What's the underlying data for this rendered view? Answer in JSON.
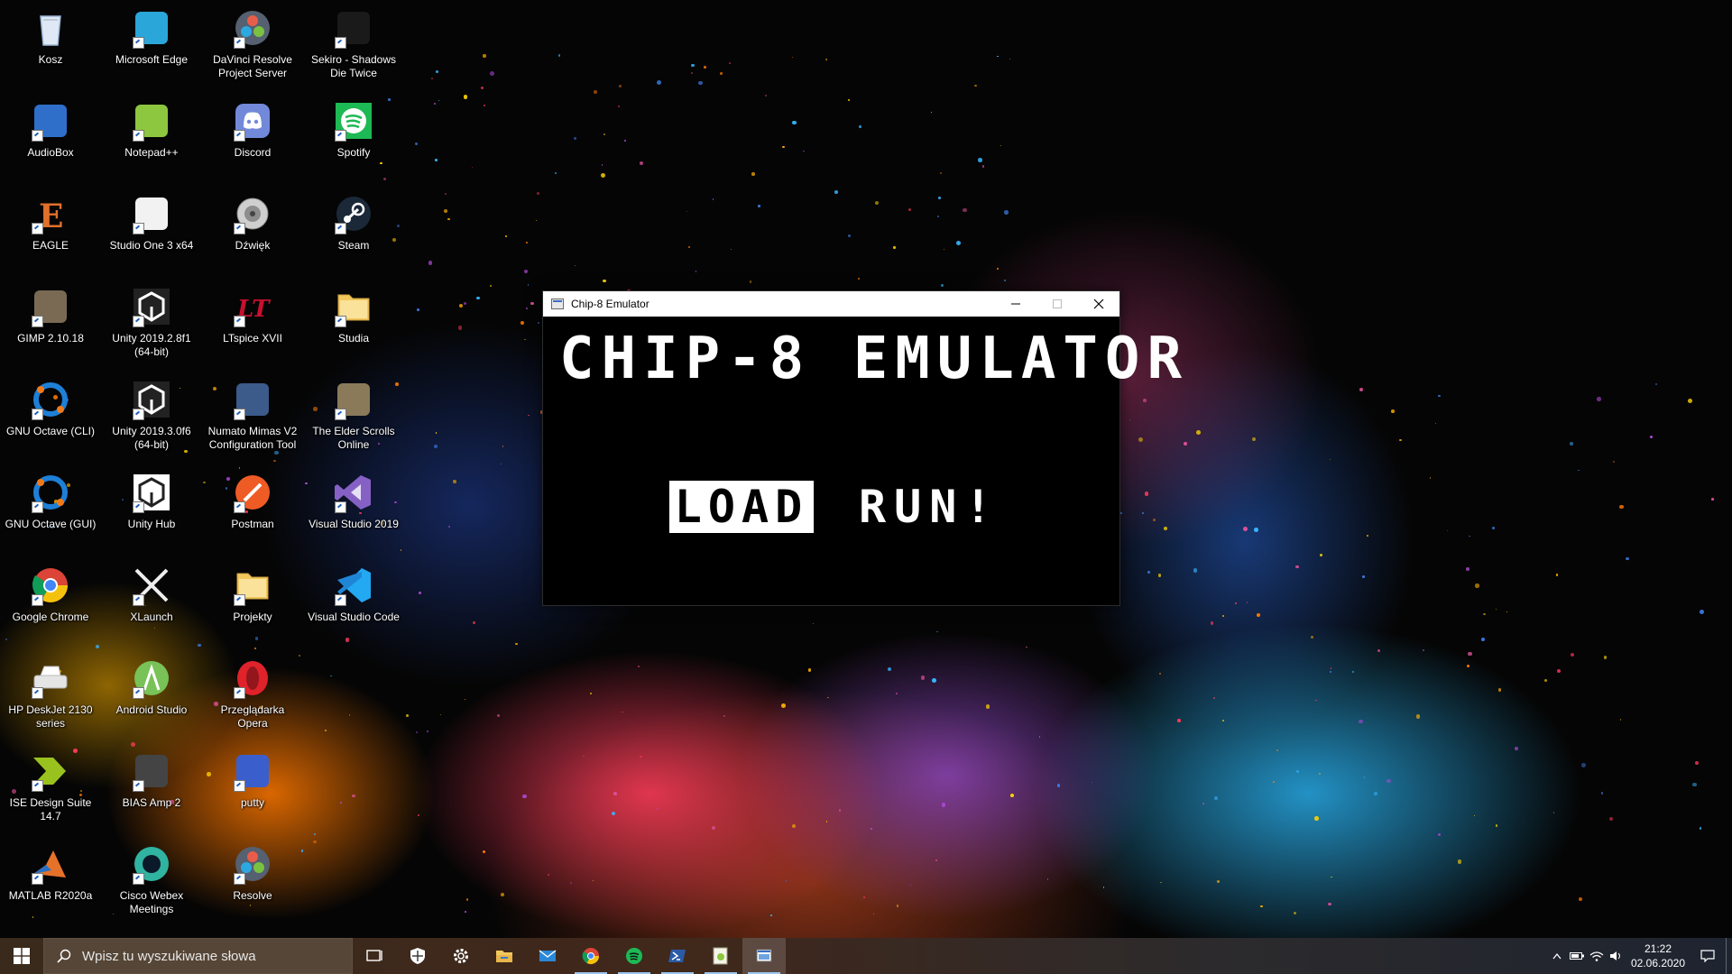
{
  "desktop": {
    "icons": [
      {
        "label": "Kosz",
        "icon": "recycle-bin-icon",
        "color": "#9bb6d6"
      },
      {
        "label": "AudioBox",
        "icon": "audiobox-icon",
        "color": "#2f6fc9"
      },
      {
        "label": "EAGLE",
        "icon": "eagle-icon",
        "color": "#e0702a"
      },
      {
        "label": "GIMP 2.10.18",
        "icon": "gimp-icon",
        "color": "#7a6a54"
      },
      {
        "label": "GNU Octave (CLI)",
        "icon": "octave-icon",
        "color": "#1e7fd6"
      },
      {
        "label": "GNU Octave (GUI)",
        "icon": "octave-icon",
        "color": "#1e7fd6"
      },
      {
        "label": "Google Chrome",
        "icon": "chrome-icon",
        "color": "#db4437"
      },
      {
        "label": "HP DeskJet 2130\nseries",
        "icon": "printer-icon",
        "color": "#dcdcdc"
      },
      {
        "label": "ISE Design Suite 14.7",
        "icon": "ise-icon",
        "color": "#9ac21e"
      },
      {
        "label": "MATLAB R2020a",
        "icon": "matlab-icon",
        "color": "#e6722a"
      },
      {
        "label": "Microsoft Edge",
        "icon": "edge-icon",
        "color": "#2aa6d9"
      },
      {
        "label": "Notepad++",
        "icon": "notepadpp-icon",
        "color": "#8dc63f"
      },
      {
        "label": "Studio One 3 x64",
        "icon": "studio-one-icon",
        "color": "#f2f2f2"
      },
      {
        "label": "Unity 2019.2.8f1\n(64-bit)",
        "icon": "unity-icon",
        "color": "#222222"
      },
      {
        "label": "Unity 2019.3.0f6\n(64-bit)",
        "icon": "unity-icon",
        "color": "#222222"
      },
      {
        "label": "Unity Hub",
        "icon": "unity-hub-icon",
        "color": "#ffffff"
      },
      {
        "label": "XLaunch",
        "icon": "xlaunch-icon",
        "color": "#dddddd"
      },
      {
        "label": "Android Studio",
        "icon": "android-studio-icon",
        "color": "#78c257"
      },
      {
        "label": "BIAS Amp 2",
        "icon": "bias-amp-icon",
        "color": "#444444"
      },
      {
        "label": "Cisco Webex\nMeetings",
        "icon": "webex-icon",
        "color": "#30b3a0"
      },
      {
        "label": "DaVinci Resolve\nProject Server",
        "icon": "davinci-icon",
        "color": "#556070"
      },
      {
        "label": "Discord",
        "icon": "discord-icon",
        "color": "#7289da"
      },
      {
        "label": "Dźwięk",
        "icon": "speaker-icon",
        "color": "#bbbbbb"
      },
      {
        "label": "LTspice XVII",
        "icon": "ltspice-icon",
        "color": "#c8102e"
      },
      {
        "label": "Numato Mimas V2\nConfiguration Tool",
        "icon": "numato-icon",
        "color": "#3c5a8a"
      },
      {
        "label": "Postman",
        "icon": "postman-icon",
        "color": "#ef5b25"
      },
      {
        "label": "Projekty",
        "icon": "folder-icon",
        "color": "#f2c75c"
      },
      {
        "label": "Przeglądarka Opera",
        "icon": "opera-icon",
        "color": "#e0222b"
      },
      {
        "label": "putty",
        "icon": "putty-icon",
        "color": "#3a5fcd"
      },
      {
        "label": "Resolve",
        "icon": "davinci-icon",
        "color": "#556070"
      },
      {
        "label": "Sekiro - Shadows\nDie Twice",
        "icon": "sekiro-icon",
        "color": "#1a1a1a"
      },
      {
        "label": "Spotify",
        "icon": "spotify-icon",
        "color": "#1db954"
      },
      {
        "label": "Steam",
        "icon": "steam-icon",
        "color": "#1b2838"
      },
      {
        "label": "Studia",
        "icon": "folder-icon",
        "color": "#f2c75c"
      },
      {
        "label": "The Elder Scrolls\nOnline",
        "icon": "eso-icon",
        "color": "#8a7a5a"
      },
      {
        "label": "Visual Studio 2019",
        "icon": "visual-studio-icon",
        "color": "#8661c5"
      },
      {
        "label": "Visual Studio Code",
        "icon": "vscode-icon",
        "color": "#23a8f2"
      }
    ]
  },
  "window": {
    "title": "Chip-8 Emulator",
    "heading": "CHIP-8 EMULATOR",
    "load_label": "LOAD",
    "run_label": "RUN!"
  },
  "taskbar": {
    "search_placeholder": "Wpisz tu wyszukiwane słowa",
    "pinned": [
      {
        "name": "task-view-icon",
        "running": false
      },
      {
        "name": "security-shield-icon",
        "running": false
      },
      {
        "name": "settings-gear-icon",
        "running": false
      },
      {
        "name": "file-explorer-icon",
        "running": false
      },
      {
        "name": "mail-icon",
        "running": false
      },
      {
        "name": "chrome-icon",
        "running": true
      },
      {
        "name": "spotify-icon",
        "running": true
      },
      {
        "name": "powershell-icon",
        "running": true
      },
      {
        "name": "notepadpp-icon",
        "running": true
      },
      {
        "name": "chip8-app-icon",
        "running": true,
        "active": true
      }
    ],
    "time": "21:22",
    "date": "02.06.2020"
  }
}
